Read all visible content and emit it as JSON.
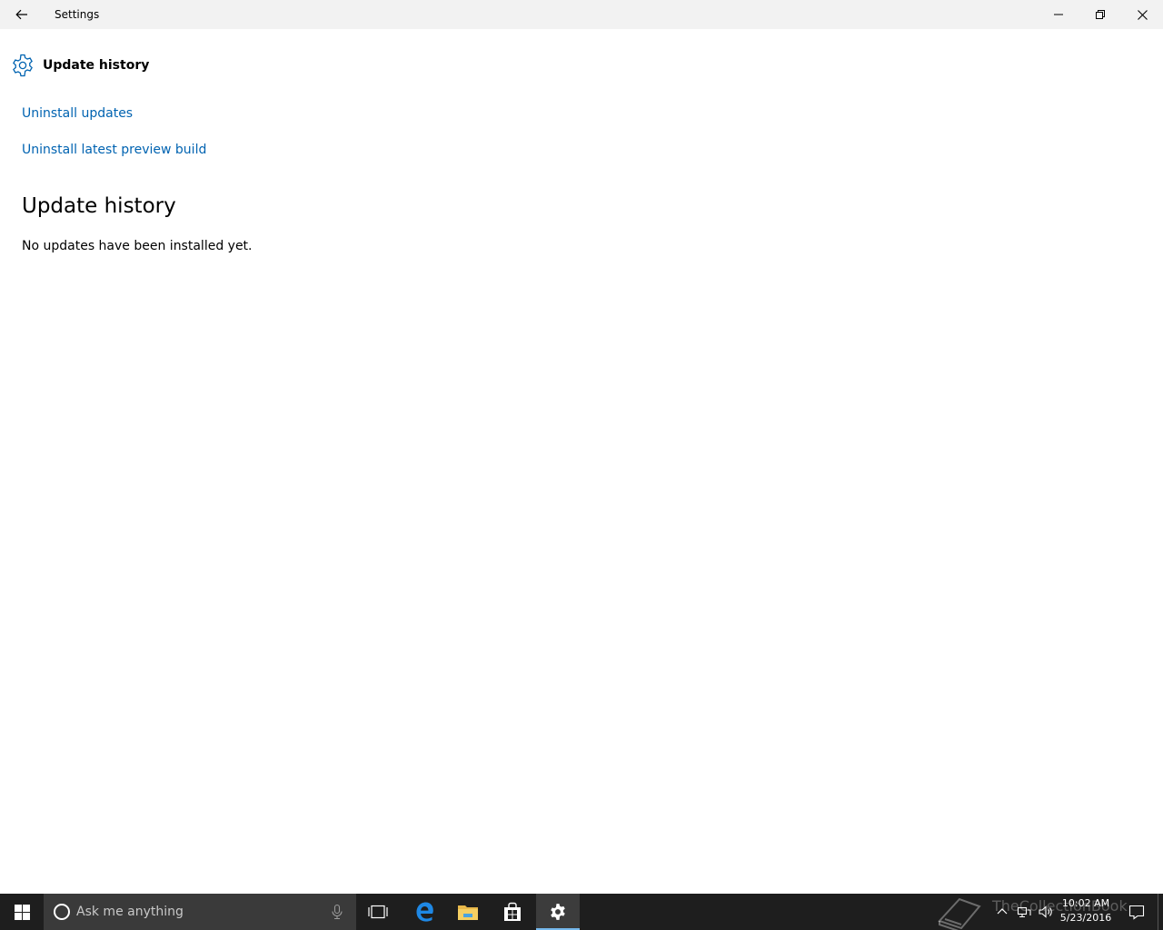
{
  "window": {
    "title": "Settings",
    "back_icon": "back-arrow-icon",
    "controls": [
      "minimize-icon",
      "restore-icon",
      "close-icon"
    ]
  },
  "page": {
    "header_icon": "gear-icon",
    "header_title": "Update history",
    "links": [
      {
        "label": "Uninstall updates"
      },
      {
        "label": "Uninstall latest preview build"
      }
    ],
    "section_title": "Update history",
    "empty_message": "No updates have been installed yet."
  },
  "taskbar": {
    "search_placeholder": "Ask me anything",
    "apps": [
      "task-view-icon",
      "edge-icon",
      "file-explorer-icon",
      "store-icon",
      "settings-icon"
    ],
    "active_app": "settings-icon",
    "watermark": "TheCollectionBook",
    "clock_time": "10:02 AM",
    "clock_date": "5/23/2016"
  },
  "colors": {
    "accent": "#0063b1",
    "titlebar": "#f2f2f2",
    "taskbar": "#1e1e1e",
    "search_box": "#3a3a3a",
    "active_indicator": "#76b9ed"
  }
}
